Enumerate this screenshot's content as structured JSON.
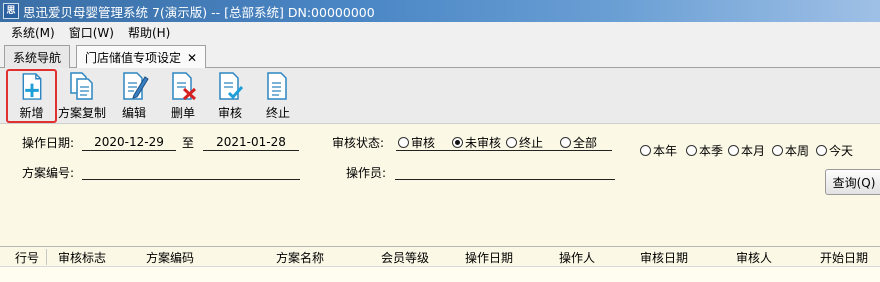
{
  "window": {
    "title": "思迅爱贝母婴管理系统 7(演示版) -- [总部系统] DN:00000000",
    "app_icon_text": "思"
  },
  "menu": [
    "系统(M)",
    "窗口(W)",
    "帮助(H)"
  ],
  "tabs": [
    {
      "label": "系统导航"
    },
    {
      "label": "门店储值专项设定",
      "close": "✕"
    }
  ],
  "toolbar": {
    "new": "新增",
    "copy": "方案复制",
    "edit": "编辑",
    "delete": "删单",
    "audit": "审核",
    "terminate": "终止"
  },
  "filter": {
    "op_date_label": "操作日期:",
    "date_from": "2020-12-29",
    "to_label": "至",
    "date_to": "2021-01-28",
    "audit_status_label": "审核状态:",
    "status_options": [
      {
        "label": "审核",
        "selected": false
      },
      {
        "label": "未审核",
        "selected": true
      },
      {
        "label": "终止",
        "selected": false
      },
      {
        "label": "全部",
        "selected": false
      }
    ],
    "period_options": [
      "本年",
      "本季",
      "本月",
      "本周",
      "今天"
    ],
    "plan_no_label": "方案编号:",
    "operator_label": "操作员:",
    "query_button": "查询(Q)"
  },
  "grid": {
    "columns": [
      "行号",
      "审核标志",
      "方案编码",
      "方案名称",
      "会员等级",
      "操作日期",
      "操作人",
      "审核日期",
      "审核人",
      "开始日期"
    ]
  }
}
